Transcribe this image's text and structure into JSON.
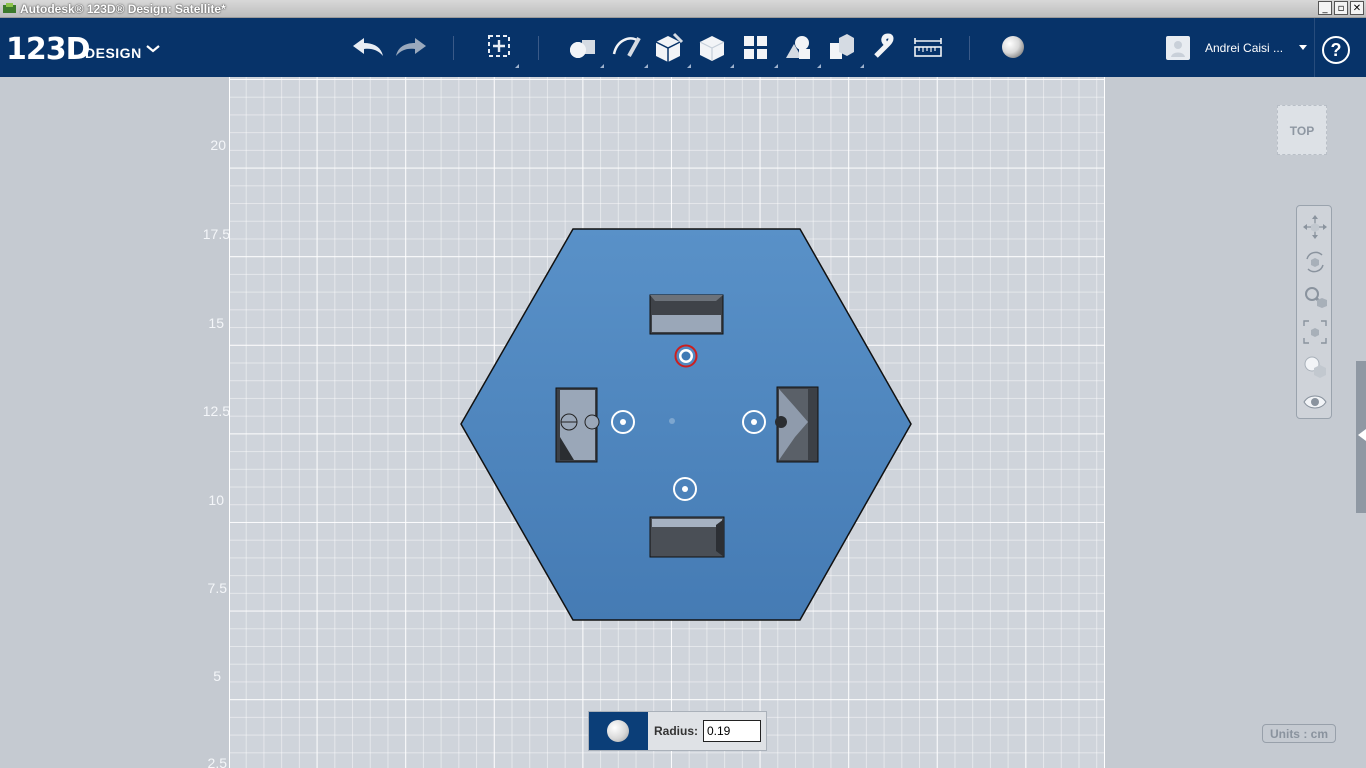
{
  "window": {
    "title": "Autodesk® 123D® Design: Satellite*",
    "buttons": [
      "_",
      "▫",
      "✕"
    ]
  },
  "app": {
    "logo_number": "123D",
    "logo_word": "DESIGN"
  },
  "toolbar": {
    "items": [
      "undo-icon",
      "redo-icon",
      "transform-icon",
      "primitives-icon",
      "sketch-icon",
      "construct-icon",
      "modify-icon",
      "pattern-icon",
      "grouping-icon",
      "combine-icon",
      "snap-icon",
      "measure-icon",
      "material-icon"
    ]
  },
  "user": {
    "name": "Andrei Caisi ..."
  },
  "help": {
    "label": "?"
  },
  "viewport": {
    "y_axis_labels": [
      "20",
      "17.5",
      "15",
      "12.5",
      "10",
      "7.5",
      "5",
      "2.5"
    ],
    "viewcube_label": "TOP"
  },
  "units": {
    "label": "Units : cm"
  },
  "radius_panel": {
    "label": "Radius:",
    "value": "0.19"
  },
  "colors": {
    "toolbar_bg": "#073369",
    "plate": "#4d86c0"
  }
}
